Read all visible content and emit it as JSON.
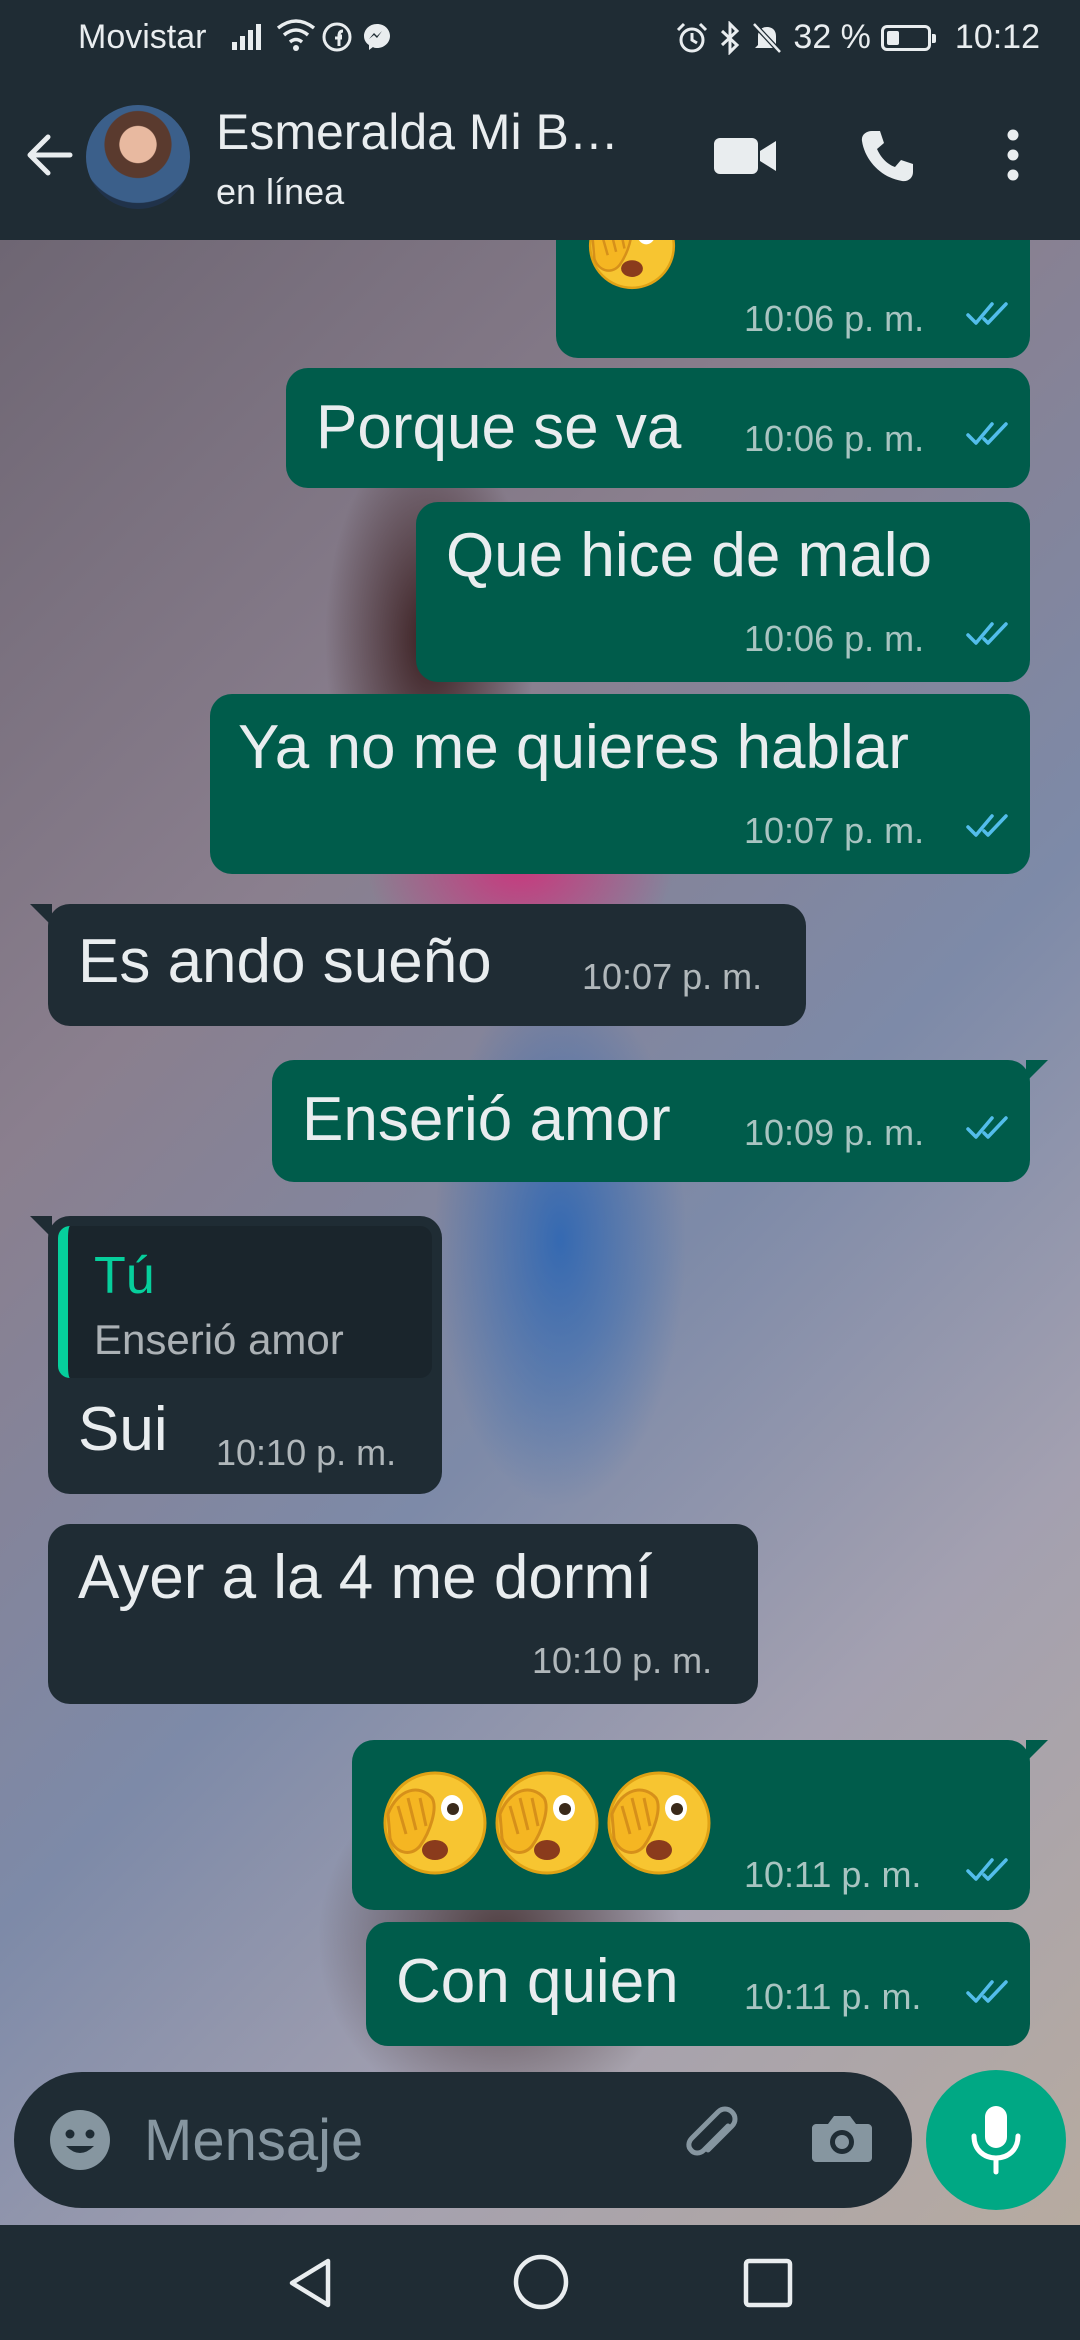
{
  "status_bar": {
    "carrier": "Movistar",
    "battery": "32 %",
    "battery_level": 0.32,
    "time": "10:12",
    "icons": [
      "signal-icon",
      "wifi-icon",
      "facebook-icon",
      "messenger-icon",
      "alarm-icon",
      "bluetooth-icon",
      "mute-icon",
      "battery-icon"
    ]
  },
  "header": {
    "contact_name": "Esmeralda Mi B…",
    "status": "en línea",
    "icons": [
      "back-arrow-icon",
      "video-call-icon",
      "phone-icon",
      "more-options-icon"
    ]
  },
  "messages": [
    {
      "direction": "out",
      "emoji": [
        "face-with-hand-over-mouth"
      ],
      "time": "10:06 p. m.",
      "read": true
    },
    {
      "direction": "out",
      "text": "Porque se va",
      "time": "10:06 p. m.",
      "read": true
    },
    {
      "direction": "out",
      "text": "Que hice de malo",
      "time": "10:06 p. m.",
      "read": true
    },
    {
      "direction": "out",
      "text": "Ya no me quieres hablar",
      "time": "10:07 p. m.",
      "read": true
    },
    {
      "direction": "in",
      "text": "Es ando sueño",
      "time": "10:07 p. m."
    },
    {
      "direction": "out",
      "text": "Enserió amor",
      "time": "10:09 p. m.",
      "read": true
    },
    {
      "direction": "in",
      "quote": {
        "author": "Tú",
        "text": "Enserió amor"
      },
      "text": "Sui",
      "time": "10:10 p. m."
    },
    {
      "direction": "in",
      "text": "Ayer a la 4 me dormí",
      "time": "10:10 p. m."
    },
    {
      "direction": "out",
      "emoji": [
        "face-with-hand-over-mouth",
        "face-with-hand-over-mouth",
        "face-with-hand-over-mouth"
      ],
      "time": "10:11 p. m.",
      "read": true
    },
    {
      "direction": "out",
      "text": "Con quien",
      "time": "10:11 p. m.",
      "read": true
    }
  ],
  "input": {
    "placeholder": "Mensaje",
    "icons": [
      "emoji-icon",
      "attach-icon",
      "camera-icon",
      "mic-icon"
    ]
  },
  "colors": {
    "header_bg": "#1f2c34",
    "outgoing_bubble": "#005c4b",
    "incoming_bubble": "#1f2c34",
    "read_ticks": "#53bdeb",
    "accent": "#00a884",
    "quote_accent": "#06cf9c"
  },
  "nav_bar": {
    "icons": [
      "nav-back-icon",
      "nav-home-icon",
      "nav-recents-icon"
    ]
  }
}
